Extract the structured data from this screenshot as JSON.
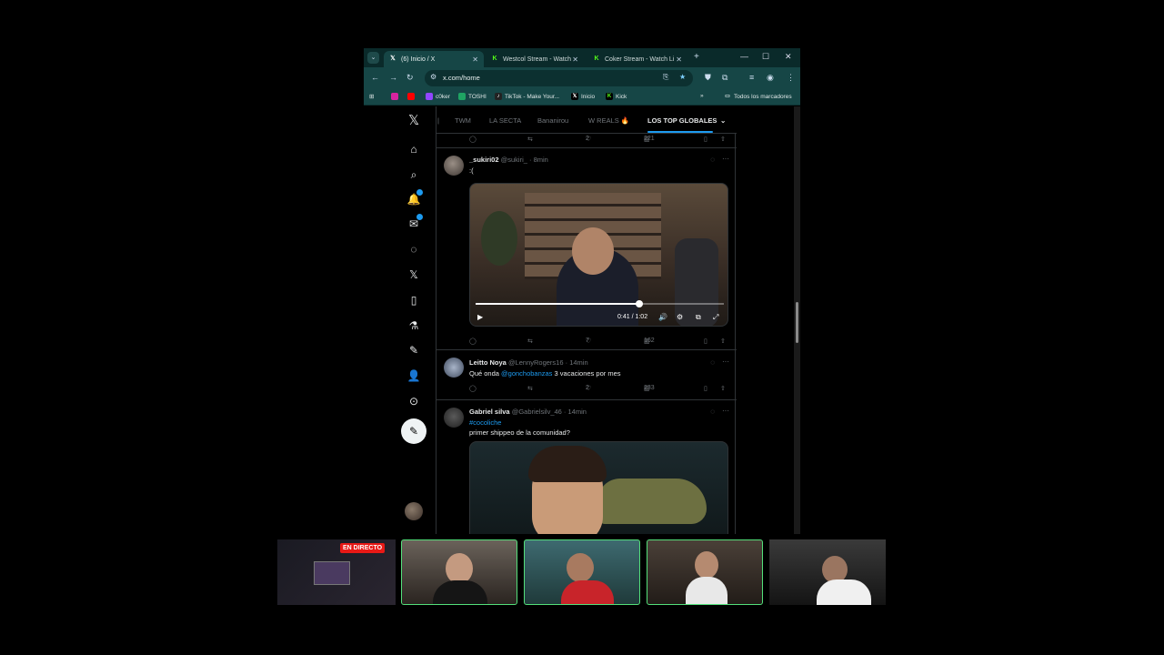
{
  "browser": {
    "tabs": [
      {
        "label": "(6) Inicio / X",
        "icon": "x-logo-icon",
        "active": true
      },
      {
        "label": "Westcol Stream - Watch",
        "icon": "kick-logo-icon",
        "active": false
      },
      {
        "label": "Coker Stream - Watch Li",
        "icon": "kick-logo-icon",
        "active": false
      }
    ],
    "url": "x.com/home",
    "bookmarks": [
      {
        "label": "c0ker",
        "icon": "twitch-icon",
        "color": "#9146ff"
      },
      {
        "label": "TOSHI",
        "icon": "sheets-icon",
        "color": "#1fa463"
      },
      {
        "label": "TikTok - Make Your...",
        "icon": "tiktok-icon",
        "color": "#111111"
      },
      {
        "label": "Inicio",
        "icon": "x-logo-icon",
        "color": "#000000"
      },
      {
        "label": "Kick",
        "icon": "kick-logo-icon",
        "color": "#53fc18"
      }
    ],
    "all_bookmarks": "Todos los marcadores"
  },
  "feed": {
    "top_tabs": [
      "TWM",
      "LA SECTA",
      "Bananirou",
      "W REALS 🔥",
      "LOS TOP GLOBALES"
    ],
    "active_tab": "LOS TOP GLOBALES",
    "prev_actions": {
      "likes": "2",
      "views": "221"
    },
    "tweets": [
      {
        "name": "_sukiri02",
        "handle": "@sukiri_",
        "time": "8min",
        "text": ":(",
        "video": {
          "current": "0:41",
          "duration": "1:02",
          "progress": 0.66
        },
        "likes": "7",
        "views": "162"
      },
      {
        "name": "Leitto Noya",
        "handle": "@LennyRogers16",
        "time": "14min",
        "mention": "@gonchobanzas",
        "text": "3 vacaciones por mes",
        "likes": "2",
        "views": "233"
      },
      {
        "name": "Gabriel silva",
        "handle": "@Gabrielsilv_46",
        "time": "14min",
        "hashtag": "#cocoliche",
        "text": "primer shippeo de la comunidad?"
      }
    ]
  },
  "stream": {
    "live_label": "EN DIRECTO",
    "accent": "#53e07a"
  }
}
